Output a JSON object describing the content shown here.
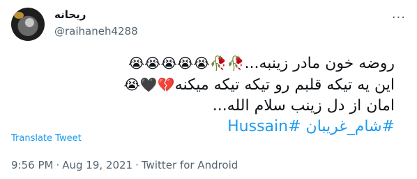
{
  "author": {
    "display_name": "ریحانه",
    "handle": "@raihaneh4288",
    "more_icon": "more-dots-icon"
  },
  "tweet": {
    "line1_text": "روضه خون مادر زینبه...",
    "line1_emoji": "🥀🥀😭😭😭😭😭",
    "line2_text": "این یه تیکه قلبم رو تیکه تیکه میکنه",
    "line2_emoji": "💔🖤😭",
    "line3_text": "امان از دل زینب سلام الله...",
    "hashtag_1": "#شام_غریبان",
    "hashtag_2": "#Hussain"
  },
  "translate_label": "Translate Tweet",
  "meta": {
    "time": "9:56 PM",
    "date": "Aug 19, 2021",
    "source": "Twitter for Android",
    "separator": "·"
  },
  "colors": {
    "link": "#1d9bf0",
    "muted": "#536471",
    "text": "#0f1419"
  }
}
